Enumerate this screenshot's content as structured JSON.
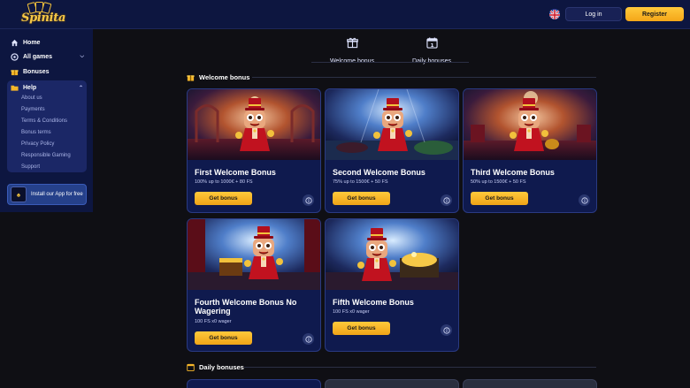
{
  "header": {
    "logo_text": "Spinita",
    "login_label": "Log in",
    "register_label": "Register",
    "language_icon": "uk-flag-icon"
  },
  "sidebar": {
    "items": [
      {
        "label": "Home",
        "icon": "home-icon"
      },
      {
        "label": "All games",
        "icon": "games-icon"
      },
      {
        "label": "Bonuses",
        "icon": "gift-icon"
      }
    ],
    "help": {
      "label": "Help",
      "subitems": [
        "About us",
        "Payments",
        "Terms & Conditions",
        "Bonus terms",
        "Privacy Policy",
        "Responsible Gaming",
        "Support"
      ]
    },
    "install_label": "Install our App for free"
  },
  "tabs": [
    {
      "label": "Welcome bonus",
      "icon": "gift-box-icon"
    },
    {
      "label": "Daily bonuses",
      "icon": "calendar-icon",
      "badge": "1"
    }
  ],
  "sections": {
    "welcome_title": "Welcome bonus",
    "daily_title": "Daily bonuses"
  },
  "bonus_cards": [
    {
      "title": "First Welcome Bonus",
      "subtitle": "100% up to 1000€ + 80 FS",
      "button": "Get bonus"
    },
    {
      "title": "Second Welcome Bonus",
      "subtitle": "75% up to 1500€ + 50 FS",
      "button": "Get bonus"
    },
    {
      "title": "Third Welcome Bonus",
      "subtitle": "50% up to 1500€ + 50 FS",
      "button": "Get bonus"
    },
    {
      "title": "Fourth Welcome Bonus No Wagering",
      "subtitle": "100 FS x0 wager",
      "button": "Get bonus"
    },
    {
      "title": "Fifth Welcome Bonus",
      "subtitle": "100 FS x0 wager",
      "button": "Get bonus"
    }
  ],
  "colors": {
    "header_bg": "#0d1640",
    "page_bg": "#0f0f14",
    "card_bg": "#0f1a4e",
    "accent": "#f6b62a"
  }
}
